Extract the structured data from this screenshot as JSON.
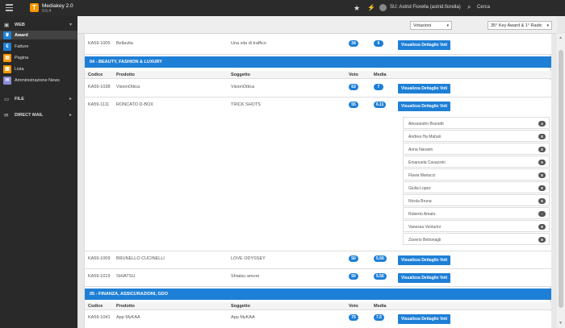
{
  "topbar": {
    "app_name": "Mediakey 2.0",
    "app_version": "9.5.4",
    "logo_glyph": "T",
    "star_icon": "★",
    "bolt_icon": "⚡",
    "user_name": "SU: Astrid Fiorella (astrid.fiorella)",
    "search_icon": "⌕",
    "search_label": "Cerca"
  },
  "sidebar": {
    "web_section": {
      "label": "WEB",
      "icon": "▣",
      "arrow": "▾"
    },
    "items": [
      {
        "label": "Award",
        "glyph": "🏆",
        "color": "#1e7fd6"
      },
      {
        "label": "Fatture",
        "glyph": "€",
        "color": "#1e7fd6"
      },
      {
        "label": "Pagina",
        "glyph": "▤",
        "color": "#f49700"
      },
      {
        "label": "Lista",
        "glyph": "▦",
        "color": "#f49700"
      },
      {
        "label": "Amministrazione News",
        "glyph": "✉",
        "color": "#8a8ad6"
      }
    ],
    "file_section": {
      "label": "FILE",
      "icon": "▭",
      "arrow": "▸"
    },
    "mail_section": {
      "label": "DIRECT MAIL",
      "icon": "✉",
      "arrow": "▸"
    }
  },
  "docheader": {
    "select_votazioni": "Votazioni",
    "select_award": "35° Key Award & 1° Radic"
  },
  "top_row": {
    "code": "KA59-1005",
    "product": "Bellavita",
    "subject": "Una vita di traffico",
    "voto": "34",
    "media": "6",
    "button": "Visualizza Dettaglio Voti"
  },
  "categories": [
    {
      "title": "04 - BEAUTY, FASHION & LUXURY",
      "headers": {
        "code": "Codice",
        "product": "Prodotto",
        "subject": "Soggetto",
        "voto": "Voto",
        "media": "Media"
      },
      "rows": [
        {
          "code": "KA59-1038",
          "product": "VisionOttica",
          "subject": "VisionOttica",
          "voto": "63",
          "media": "7",
          "button": "Visualizza Dettaglio Voti"
        },
        {
          "code": "KA59-1111",
          "product": "RONCATO D-BOX",
          "subject": "TRICK SHOTS",
          "voto": "55",
          "media": "6.11",
          "button": "Visualizza Dettaglio Voti"
        },
        {
          "code": "KA59-1009",
          "product": "BRUNELLO CUCINELLI",
          "subject": "LOVE ODYSSEY",
          "voto": "50",
          "media": "5.56",
          "button": "Visualizza Dettaglio Voti"
        },
        {
          "code": "KA59-1019",
          "product": "SHIATSU",
          "subject": "Shiatsu amore",
          "voto": "50",
          "media": "5.56",
          "button": "Visualizza Dettaglio Voti"
        }
      ],
      "voters": [
        {
          "name": "Alessandro Brunetti",
          "score": "4"
        },
        {
          "name": "Andrea Ha Mahali",
          "score": "8"
        },
        {
          "name": "Anna Navarin",
          "score": "8"
        },
        {
          "name": "Emanuela Cavazzini",
          "score": "5"
        },
        {
          "name": "Flavia Mariucci",
          "score": "8"
        },
        {
          "name": "Giulia Lopez",
          "score": "8"
        },
        {
          "name": "Nicola Bruna",
          "score": "8"
        },
        {
          "name": "Roberto Amato",
          "score": "-"
        },
        {
          "name": "Vanessa Venturini",
          "score": "8"
        },
        {
          "name": "Zaverio Bettonagli",
          "score": "8"
        }
      ]
    },
    {
      "title": "05 - FINANZA, ASSICURAZIONI, GDO",
      "headers": {
        "code": "Codice",
        "product": "Prodotto",
        "subject": "Soggetto",
        "voto": "Voto",
        "media": "Media"
      },
      "rows": [
        {
          "code": "KA59-1041",
          "product": "App MyKAA",
          "subject": "App MyKAA",
          "voto": "75",
          "media": "7.5",
          "button": "Visualizza Dettaglio Voti"
        }
      ]
    }
  ],
  "scrollbar": {
    "up": "▲",
    "down": "▼"
  }
}
